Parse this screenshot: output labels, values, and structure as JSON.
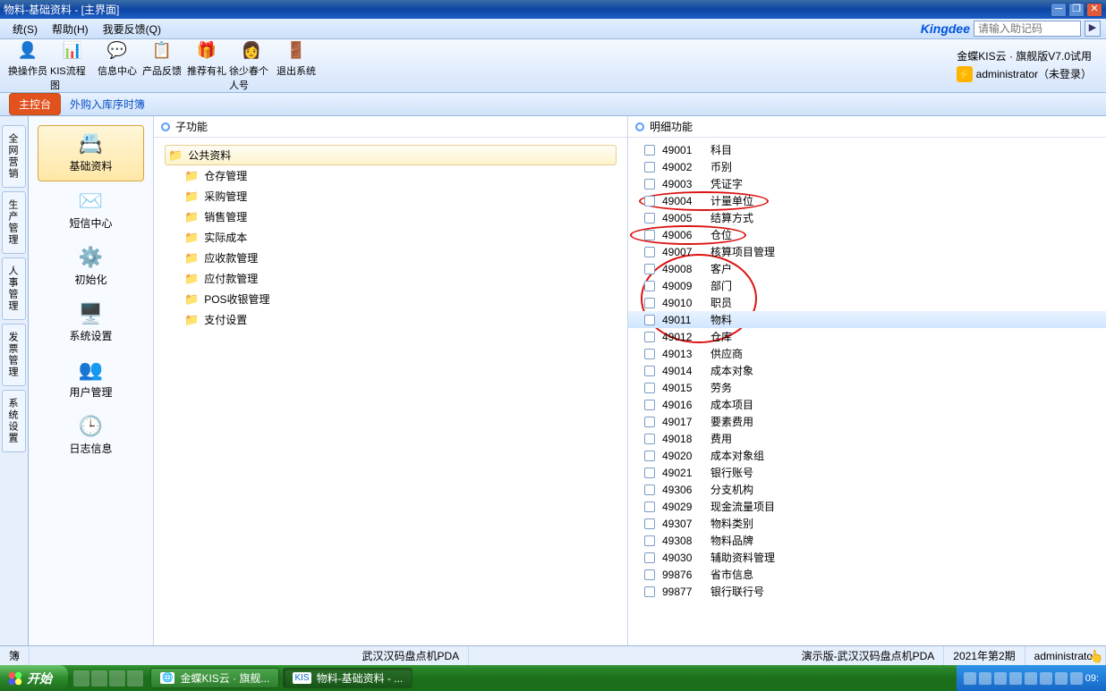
{
  "window": {
    "title": "物料-基础资料 - [主界面]"
  },
  "menu": {
    "items": [
      "统(S)",
      "帮助(H)",
      "我要反馈(Q)"
    ],
    "brand": "Kingdee",
    "search_placeholder": "请输入助记码"
  },
  "toolbar": {
    "items": [
      {
        "icon": "👤",
        "label": "换操作员"
      },
      {
        "icon": "📊",
        "label": "KIS流程图"
      },
      {
        "icon": "💬",
        "label": "信息中心"
      },
      {
        "icon": "📋",
        "label": "产品反馈"
      },
      {
        "icon": "🎁",
        "label": "推荐有礼"
      },
      {
        "icon": "👩",
        "label": "徐少春个人号"
      },
      {
        "icon": "🚪",
        "label": "退出系统"
      }
    ],
    "version": "金蝶KIS云 · 旗舰版V7.0试用",
    "user": "administrator（未登录）"
  },
  "tabs": {
    "main": "主控台",
    "sub": "外购入库序时簿"
  },
  "vtabs": [
    "全网营销",
    "生产管理",
    "人事管理",
    "发票管理",
    "系统设置"
  ],
  "sidebar": {
    "items": [
      {
        "icon": "📇",
        "label": "基础资料",
        "sel": true
      },
      {
        "icon": "✉️",
        "label": "短信中心"
      },
      {
        "icon": "⚙️",
        "label": "初始化"
      },
      {
        "icon": "🖥️",
        "label": "系统设置"
      },
      {
        "icon": "👥",
        "label": "用户管理"
      },
      {
        "icon": "🕒",
        "label": "日志信息"
      }
    ]
  },
  "mid": {
    "header": "子功能",
    "tree": [
      {
        "label": "公共资料",
        "sel": true
      },
      {
        "label": "仓存管理"
      },
      {
        "label": "采购管理"
      },
      {
        "label": "销售管理"
      },
      {
        "label": "实际成本"
      },
      {
        "label": "应收款管理"
      },
      {
        "label": "应付款管理"
      },
      {
        "label": "POS收银管理"
      },
      {
        "label": "支付设置"
      }
    ]
  },
  "right": {
    "header": "明细功能",
    "rows": [
      {
        "code": "49001",
        "label": "科目"
      },
      {
        "code": "49002",
        "label": "币别"
      },
      {
        "code": "49003",
        "label": "凭证字"
      },
      {
        "code": "49004",
        "label": "计量单位"
      },
      {
        "code": "49005",
        "label": "结算方式"
      },
      {
        "code": "49006",
        "label": "仓位"
      },
      {
        "code": "49007",
        "label": "核算项目管理"
      },
      {
        "code": "49008",
        "label": "客户"
      },
      {
        "code": "49009",
        "label": "部门"
      },
      {
        "code": "49010",
        "label": "职员"
      },
      {
        "code": "49011",
        "label": "物料",
        "sel": true
      },
      {
        "code": "49012",
        "label": "仓库"
      },
      {
        "code": "49013",
        "label": "供应商"
      },
      {
        "code": "49014",
        "label": "成本对象"
      },
      {
        "code": "49015",
        "label": "劳务"
      },
      {
        "code": "49016",
        "label": "成本项目"
      },
      {
        "code": "49017",
        "label": "要素费用"
      },
      {
        "code": "49018",
        "label": "费用"
      },
      {
        "code": "49020",
        "label": "成本对象组"
      },
      {
        "code": "49021",
        "label": "银行账号"
      },
      {
        "code": "49306",
        "label": "分支机构"
      },
      {
        "code": "49029",
        "label": "现金流量项目"
      },
      {
        "code": "49307",
        "label": "物料类别"
      },
      {
        "code": "49308",
        "label": "物料品牌"
      },
      {
        "code": "49030",
        "label": "辅助资料管理"
      },
      {
        "code": "99876",
        "label": "省市信息"
      },
      {
        "code": "99877",
        "label": "银行联行号"
      }
    ]
  },
  "status": {
    "left": "簿",
    "center": "武汉汉码盘点机PDA",
    "demo": "演示版-武汉汉码盘点机PDA",
    "period": "2021年第2期",
    "user": "administrator"
  },
  "taskbar": {
    "start": "开始",
    "tasks": [
      {
        "icon": "🌐",
        "label": "金蝶KIS云 · 旗舰..."
      },
      {
        "icon": "KIS",
        "label": "物料-基础资料 - ...",
        "active": true
      }
    ],
    "time": "09:"
  }
}
